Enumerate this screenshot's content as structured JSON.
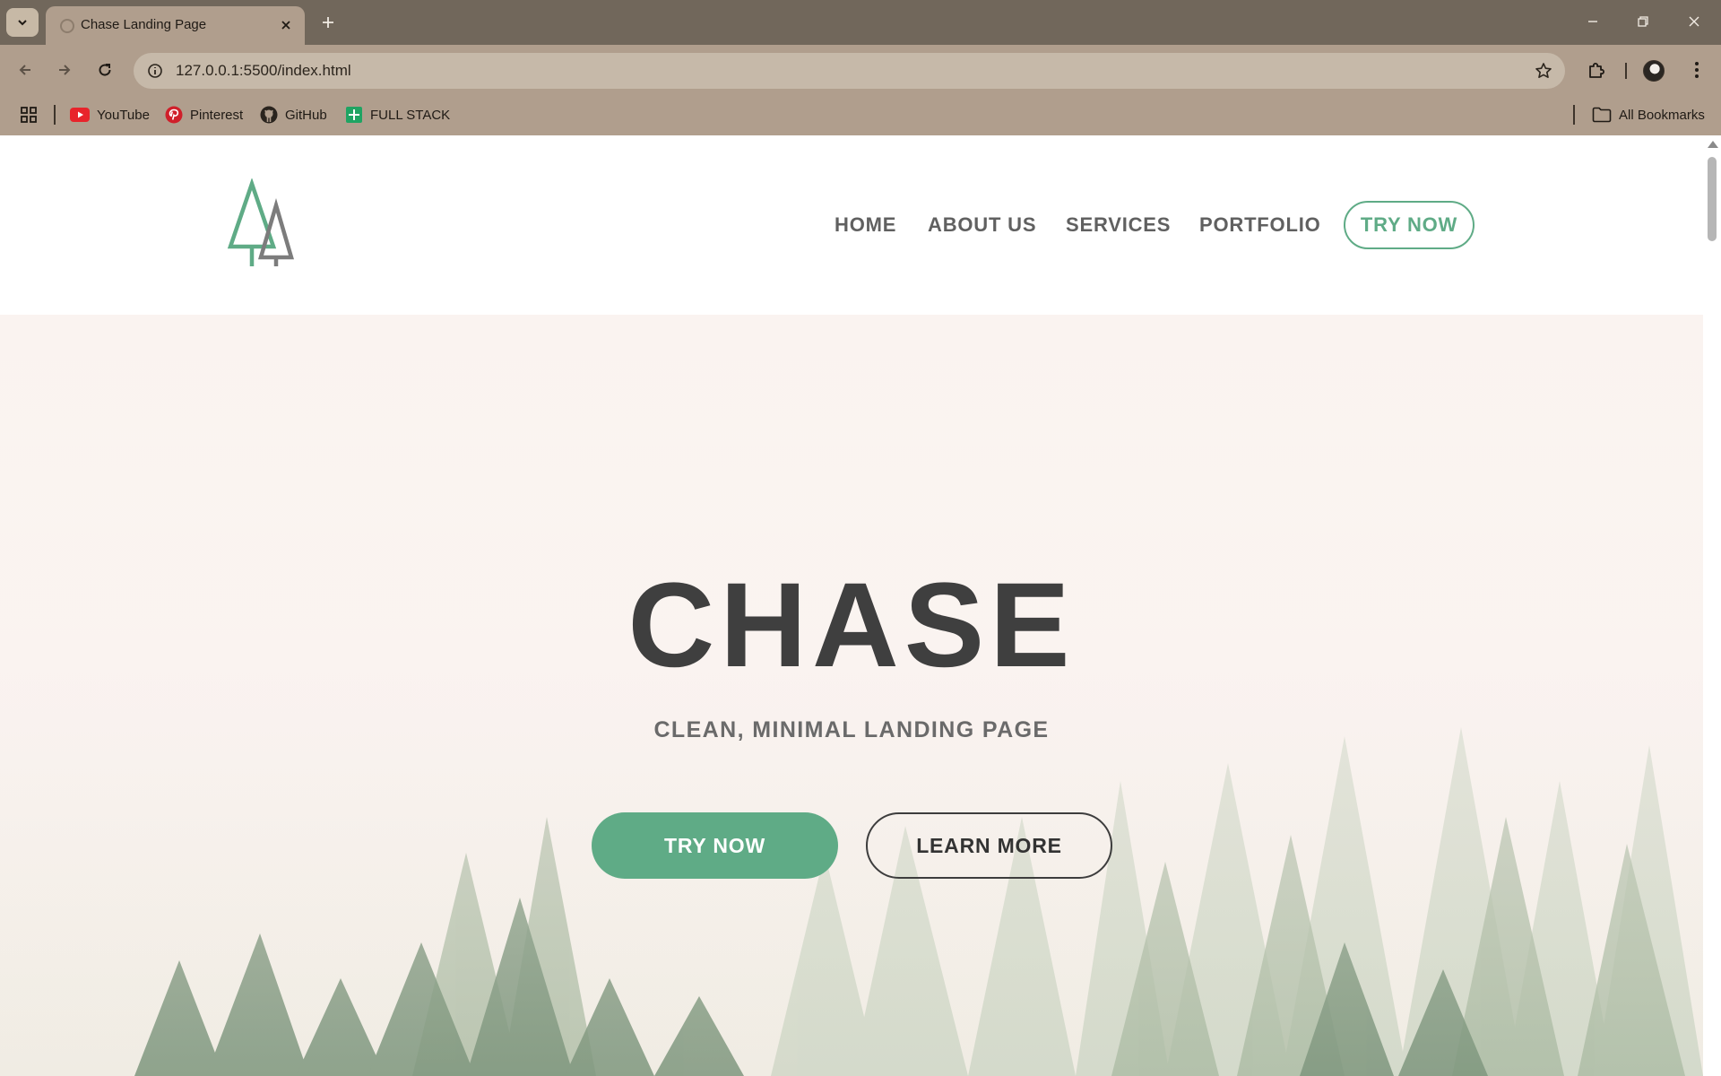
{
  "browser": {
    "tab_title": "Chase Landing Page",
    "url": "127.0.0.1:5500/index.html",
    "bookmarks": [
      {
        "label": "YouTube",
        "icon": "youtube-icon"
      },
      {
        "label": "Pinterest",
        "icon": "pinterest-icon"
      },
      {
        "label": "GitHub",
        "icon": "github-icon"
      },
      {
        "label": "FULL STACK",
        "icon": "spreadsheet-icon"
      }
    ],
    "all_bookmarks": "All Bookmarks"
  },
  "site": {
    "nav": {
      "items": [
        "HOME",
        "ABOUT US",
        "SERVICES",
        "PORTFOLIO"
      ],
      "cta": "TRY NOW"
    },
    "hero": {
      "title": "CHASE",
      "subtitle": "CLEAN, MINIMAL LANDING PAGE",
      "primary_button": "TRY NOW",
      "secondary_button": "LEARN MORE"
    }
  },
  "colors": {
    "accent": "#5fab86",
    "text_dark": "#3f3f3f",
    "nav_text": "#606060",
    "chrome": "#b09e8d"
  }
}
